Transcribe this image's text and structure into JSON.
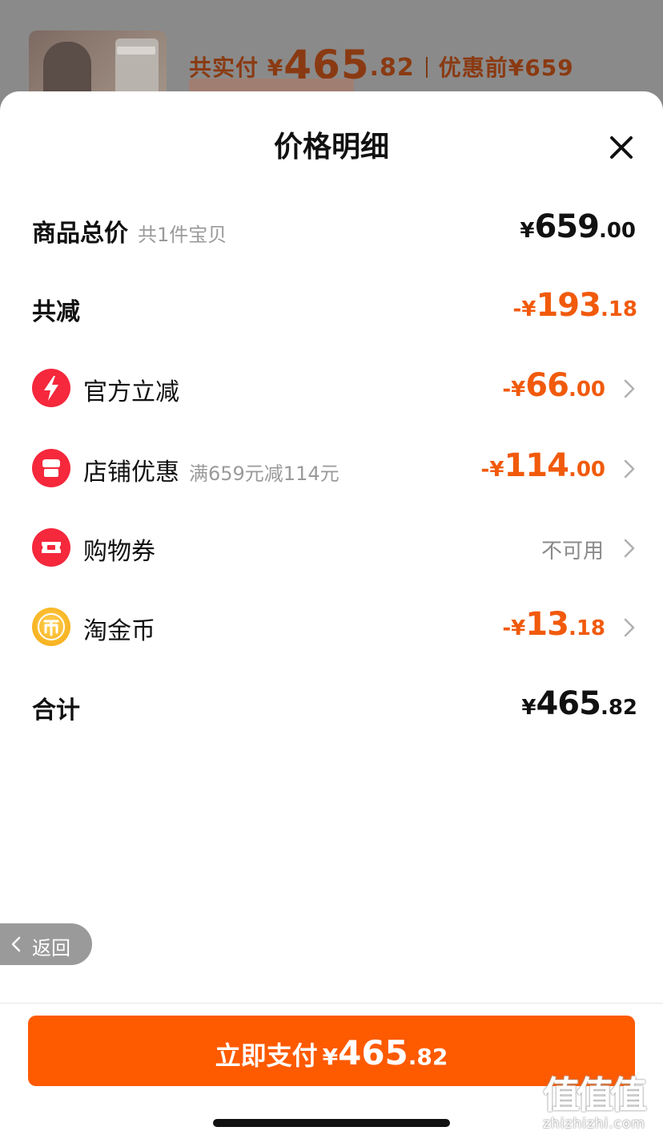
{
  "background": {
    "paid_label": "共实付 ¥",
    "paid_int": "465",
    "paid_dec": ".82",
    "before_label": "优惠前¥659"
  },
  "sheet": {
    "title": "价格明细",
    "close_icon": "close-icon"
  },
  "rows": {
    "subtotal": {
      "label": "商品总价",
      "sub": "共1件宝贝",
      "cur": "¥",
      "int": "659",
      "dec": ".00"
    },
    "total_discount": {
      "label": "共减",
      "cur": "-¥",
      "int": "193",
      "dec": ".18"
    },
    "official": {
      "label": "官方立减",
      "cur": "-¥",
      "int": "66",
      "dec": ".00",
      "icon": "lightning-icon"
    },
    "shop": {
      "label": "店铺优惠",
      "sub": "满659元减114元",
      "cur": "-¥",
      "int": "114",
      "dec": ".00",
      "icon": "shop-icon"
    },
    "voucher": {
      "label": "购物券",
      "status": "不可用",
      "icon": "ticket-icon"
    },
    "coins": {
      "label": "淘金币",
      "cur": "-¥",
      "int": "13",
      "dec": ".18",
      "icon": "coin-icon"
    },
    "sum": {
      "label": "合计",
      "cur": "¥",
      "int": "465",
      "dec": ".82"
    }
  },
  "back": {
    "label": "返回"
  },
  "pay": {
    "label": "立即支付",
    "cur": "¥",
    "int": "465",
    "dec": ".82"
  },
  "watermark": {
    "logo": "值值值",
    "url": "zhizhizhi.com"
  },
  "colors": {
    "accent": "#fe5a00",
    "discount": "#f15a0c",
    "icon_red": "#f5283c",
    "coin": "#f7b21f"
  }
}
